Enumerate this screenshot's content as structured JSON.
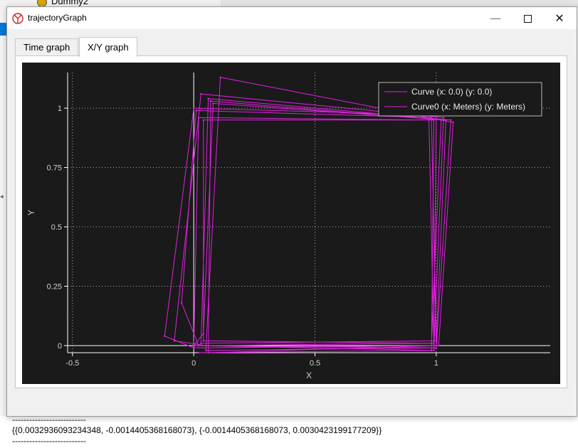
{
  "background": {
    "tree_item_label": "Dummy2"
  },
  "window": {
    "title": "trajectoryGraph",
    "minimize_symbol": "—",
    "close_symbol": "✕"
  },
  "tabs": [
    {
      "label": "Time graph",
      "active": false
    },
    {
      "label": "X/Y graph",
      "active": true
    }
  ],
  "chart_data": {
    "type": "line",
    "xlabel": "X",
    "ylabel": "Y",
    "xlim": [
      -0.52,
      1.47
    ],
    "ylim": [
      -0.03,
      1.15
    ],
    "x_ticks": [
      "-0.5",
      "0",
      "0.5",
      "1"
    ],
    "y_ticks": [
      "0",
      "0.25",
      "0.5",
      "0.75",
      "1"
    ],
    "grid": true,
    "legend_position": "top-right",
    "colors": {
      "background": "#1a1a1a",
      "axis": "#ffffff",
      "grid": "#aaaaaa",
      "series": "#e020e0"
    },
    "series": [
      {
        "name": "Curve (x: 0.0) (y: 0.0)",
        "points": [
          [
            0,
            0
          ]
        ]
      },
      {
        "name": "Curve0 (x: Meters) (y: Meters)",
        "points": [
          [
            0,
            0
          ],
          [
            0.02,
            0.96
          ],
          [
            0.97,
            0.95
          ],
          [
            0.99,
            -0.01
          ],
          [
            0.02,
            0.0
          ],
          [
            -0.05,
            0.18
          ],
          [
            0.01,
            0.99
          ],
          [
            0.98,
            0.96
          ],
          [
            1.0,
            0.0
          ],
          [
            0.0,
            -0.01
          ],
          [
            -0.12,
            0.04
          ],
          [
            0.0,
            1.0
          ],
          [
            1.0,
            0.97
          ],
          [
            0.99,
            0.01
          ],
          [
            0.05,
            0.0
          ],
          [
            -0.08,
            0.02
          ],
          [
            0.03,
            1.06
          ],
          [
            1.03,
            0.96
          ],
          [
            0.99,
            -0.02
          ],
          [
            0.0,
            0.0
          ],
          [
            0.04,
            0.05
          ],
          [
            0.08,
            1.02
          ],
          [
            1.04,
            0.95
          ],
          [
            1.0,
            0.02
          ],
          [
            0.03,
            0.01
          ],
          [
            0.06,
            1.04
          ],
          [
            1.06,
            0.95
          ],
          [
            1.0,
            -0.01
          ],
          [
            0.05,
            -0.02
          ],
          [
            0.11,
            1.13
          ],
          [
            1.07,
            0.94
          ],
          [
            1.01,
            0.0
          ],
          [
            0.06,
            -0.03
          ],
          [
            0.07,
            1.03
          ],
          [
            1.02,
            0.95
          ],
          [
            0.98,
            0.01
          ],
          [
            0.04,
            0.02
          ],
          [
            0.04,
            0.95
          ],
          [
            0.99,
            0.95
          ],
          [
            0.98,
            -0.02
          ],
          [
            0.02,
            -0.03
          ]
        ]
      }
    ]
  },
  "console": {
    "divider": "--------------------------",
    "output": "{{0.0032936093234348, -0.0014405368168073}, {-0.0014405368168073, 0.0030423199177209}}"
  }
}
